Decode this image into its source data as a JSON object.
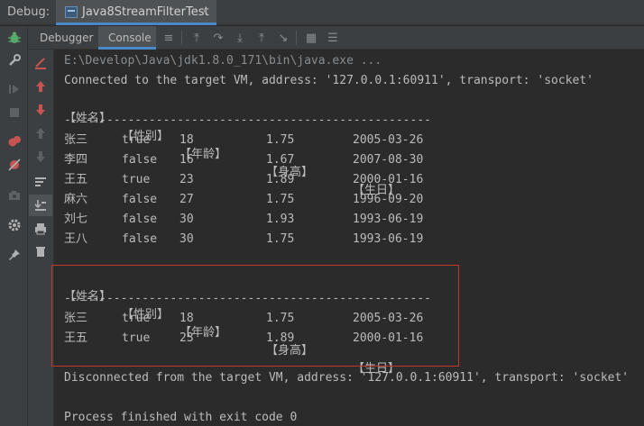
{
  "topbar": {
    "debug_label": "Debug:",
    "tab_title": "Java8StreamFilterTest",
    "close_glyph": "×"
  },
  "subtabs": {
    "debugger": "Debugger",
    "console": "Console"
  },
  "console": {
    "cmd_line": "E:\\Develop\\Java\\jdk1.8.0_171\\bin\\java.exe ...",
    "connected_line": "Connected to the target VM, address: '127.0.0.1:60911', transport: 'socket'",
    "headers": [
      "【姓名】",
      "【性别】",
      "【年龄】",
      "【身高】",
      "【生日】"
    ],
    "divider": "----------------------------------------------------",
    "rows_all": [
      [
        "张三",
        "true",
        "18",
        "1.75",
        "2005-03-26"
      ],
      [
        "李四",
        "false",
        "16",
        "1.67",
        "2007-08-30"
      ],
      [
        "王五",
        "true",
        "23",
        "1.89",
        "2000-01-16"
      ],
      [
        "麻六",
        "false",
        "27",
        "1.75",
        "1996-09-20"
      ],
      [
        "刘七",
        "false",
        "30",
        "1.93",
        "1993-06-19"
      ],
      [
        "王八",
        "false",
        "30",
        "1.75",
        "1993-06-19"
      ]
    ],
    "rows_filtered": [
      [
        "张三",
        "true",
        "18",
        "1.75",
        "2005-03-26"
      ],
      [
        "王五",
        "true",
        "23",
        "1.89",
        "2000-01-16"
      ]
    ],
    "disconnected_line": "Disconnected from the target VM, address: '127.0.0.1:60911', transport: 'socket'",
    "finished_line": "Process finished with exit code 0"
  },
  "colors": {
    "accent": "#4a88c7",
    "highlight_border": "#c0392b",
    "stop_red": "#c75450",
    "bug_green": "#59a869"
  }
}
